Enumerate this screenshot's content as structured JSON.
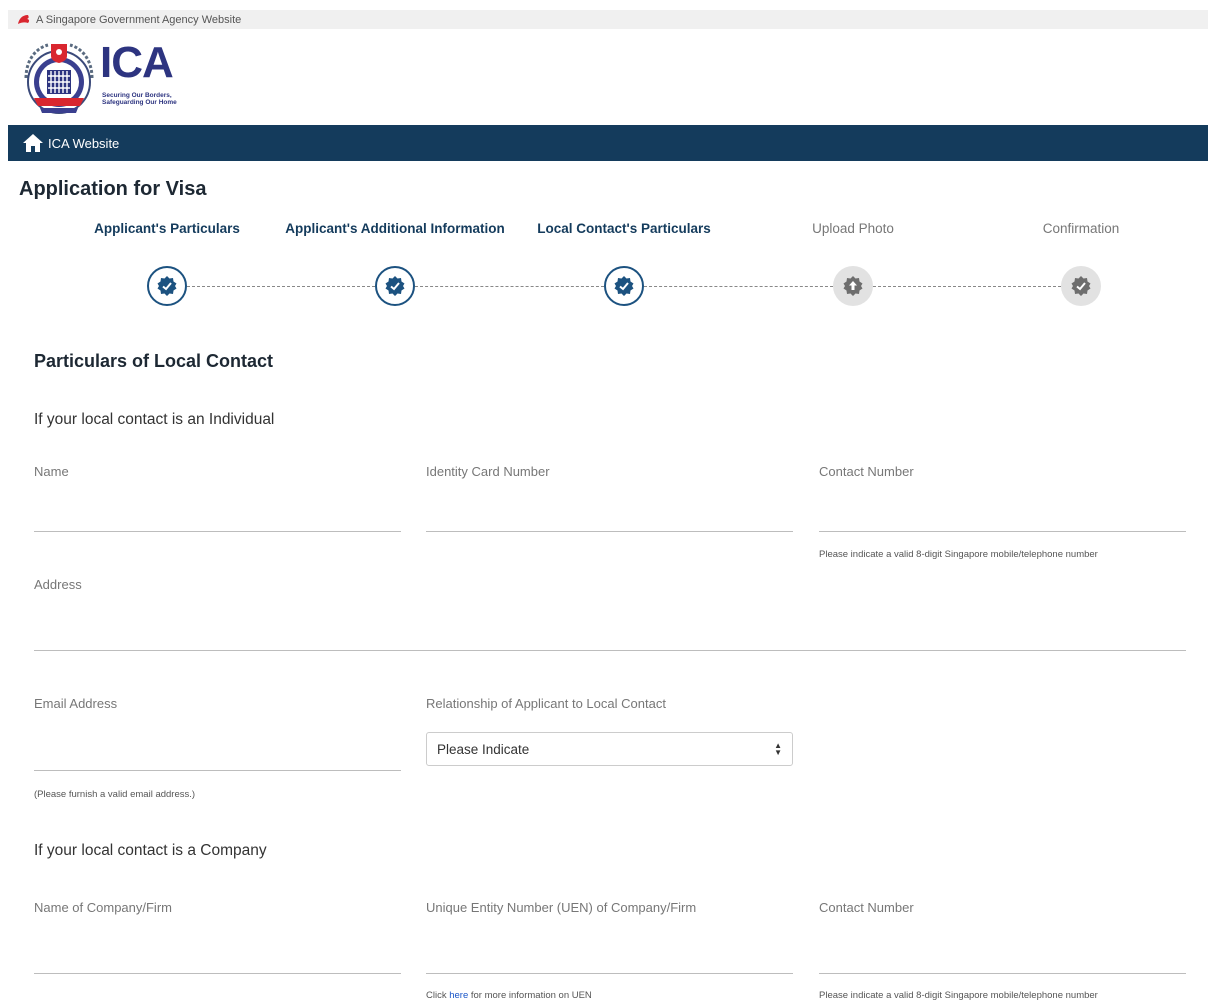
{
  "gov_banner": {
    "text": "A Singapore Government Agency Website"
  },
  "logo": {
    "name": "ICA",
    "tagline_1": "Securing Our Borders,",
    "tagline_2": "Safeguarding Our Home"
  },
  "nav": {
    "home_label": "ICA Website"
  },
  "page": {
    "title": "Application for Visa"
  },
  "steps": [
    {
      "label": "Applicant's Particulars",
      "status": "completed",
      "icon": "check-badge-icon"
    },
    {
      "label": "Applicant's Additional Information",
      "status": "completed",
      "icon": "check-badge-icon"
    },
    {
      "label": "Local Contact's Particulars",
      "status": "completed",
      "icon": "check-badge-icon"
    },
    {
      "label": "Upload Photo",
      "status": "pending",
      "icon": "upload-badge-icon"
    },
    {
      "label": "Confirmation",
      "status": "pending",
      "icon": "check-badge-icon"
    }
  ],
  "section": {
    "title": "Particulars of Local Contact"
  },
  "individual": {
    "heading": "If your local contact is an Individual",
    "name_label": "Name",
    "name_value": "",
    "ic_label": "Identity Card Number",
    "ic_value": "",
    "contact_label": "Contact Number",
    "contact_value": "",
    "contact_hint": "Please indicate a valid 8-digit Singapore mobile/telephone number",
    "address_label": "Address",
    "address_value": "",
    "email_label": "Email Address",
    "email_value": "",
    "email_hint": "(Please furnish a valid email address.)",
    "relationship_label": "Relationship of Applicant to Local Contact",
    "relationship_selected": "Please Indicate"
  },
  "company": {
    "heading": "If your local contact is a Company",
    "name_label": "Name of Company/Firm",
    "name_value": "",
    "uen_label": "Unique Entity Number (UEN) of Company/Firm",
    "uen_value": "",
    "uen_hint_prefix": "Click ",
    "uen_hint_link": "here",
    "uen_hint_suffix": " for more information on UEN",
    "contact_label": "Contact Number",
    "contact_value": "",
    "contact_hint": "Please indicate a valid 8-digit Singapore mobile/telephone number"
  },
  "colors": {
    "nav_bar": "#143b5c",
    "step_done": "#1c5280",
    "step_pending": "#e2e2e2",
    "link": "#1a56c8",
    "lion_red": "#d9262f"
  }
}
